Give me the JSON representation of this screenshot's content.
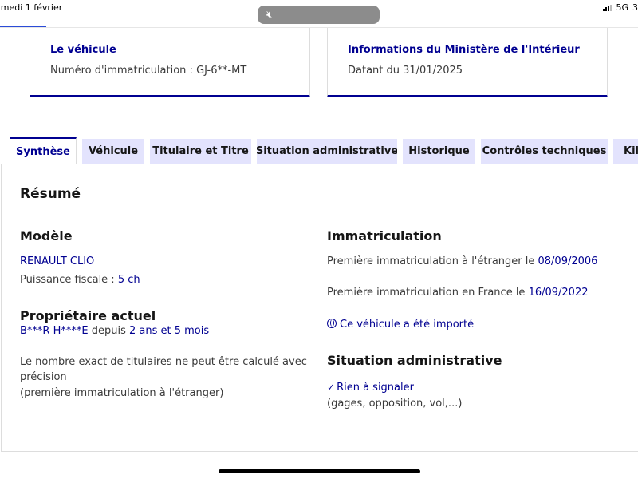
{
  "status_bar": {
    "date": "amedi 1 février",
    "network": "5G",
    "battery_fragment": "3"
  },
  "cards": {
    "vehicle": {
      "title": "Le véhicule",
      "plate_label": "Numéro d'immatriculation : GJ-6**-MT"
    },
    "ministry": {
      "title": "Informations du Ministère de l'Intérieur",
      "date_label": "Datant du 31/01/2025"
    }
  },
  "tabs": [
    {
      "label": "Synthèse",
      "active": true
    },
    {
      "label": "Véhicule"
    },
    {
      "label": "Titulaire et Titre"
    },
    {
      "label": "Situation administrative"
    },
    {
      "label": "Historique"
    },
    {
      "label": "Contrôles techniques"
    },
    {
      "label": "Kil"
    }
  ],
  "summary": {
    "title": "Résumé",
    "model": {
      "heading": "Modèle",
      "name": "RENAULT CLIO",
      "power_label": "Puissance fiscale : ",
      "power_value": "5 ch"
    },
    "owner": {
      "heading": "Propriétaire actuel",
      "name": "B***R H****E",
      "since_label": " depuis ",
      "duration": "2 ans et 5 mois",
      "note_line1": "Le nombre exact de titulaires ne peut être calculé avec",
      "note_line2": "précision",
      "note_line3": "(première immatriculation à l'étranger)"
    },
    "registration": {
      "heading": "Immatriculation",
      "foreign_label": "Première immatriculation à l'étranger le ",
      "foreign_date": "08/09/2006",
      "france_label": "Première immatriculation en France le ",
      "france_date": "16/09/2022",
      "imported_link": "Ce véhicule a été importé"
    },
    "admin": {
      "heading": "Situation administrative",
      "status": "Rien à signaler",
      "details": "(gages, opposition, vol,...)"
    }
  }
}
